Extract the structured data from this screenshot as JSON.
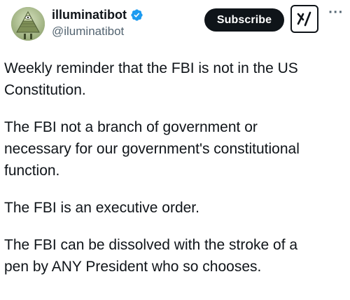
{
  "header": {
    "display_name": "illuminatibot",
    "handle": "@iluminatibot",
    "verified": true,
    "subscribe_label": "Subscribe",
    "grok_icon": "grok-x-slash-icon",
    "more_icon": "ellipsis-icon",
    "more_glyph": "···"
  },
  "tweet": {
    "paragraphs": [
      "Weekly reminder that the FBI is not in the US\nConstitution.",
      "The FBI not a branch of government or\nnecessary for our government's constitutional\nfunction.",
      "The FBI is an executive order.",
      "The FBI can be dissolved with the stroke of a\npen by ANY President who so chooses."
    ]
  },
  "colors": {
    "text_primary": "#0f1419",
    "text_secondary": "#536471",
    "verified_blue": "#1d9bf0",
    "button_dark": "#0f1419",
    "avatar_green": "#a6b88c"
  }
}
